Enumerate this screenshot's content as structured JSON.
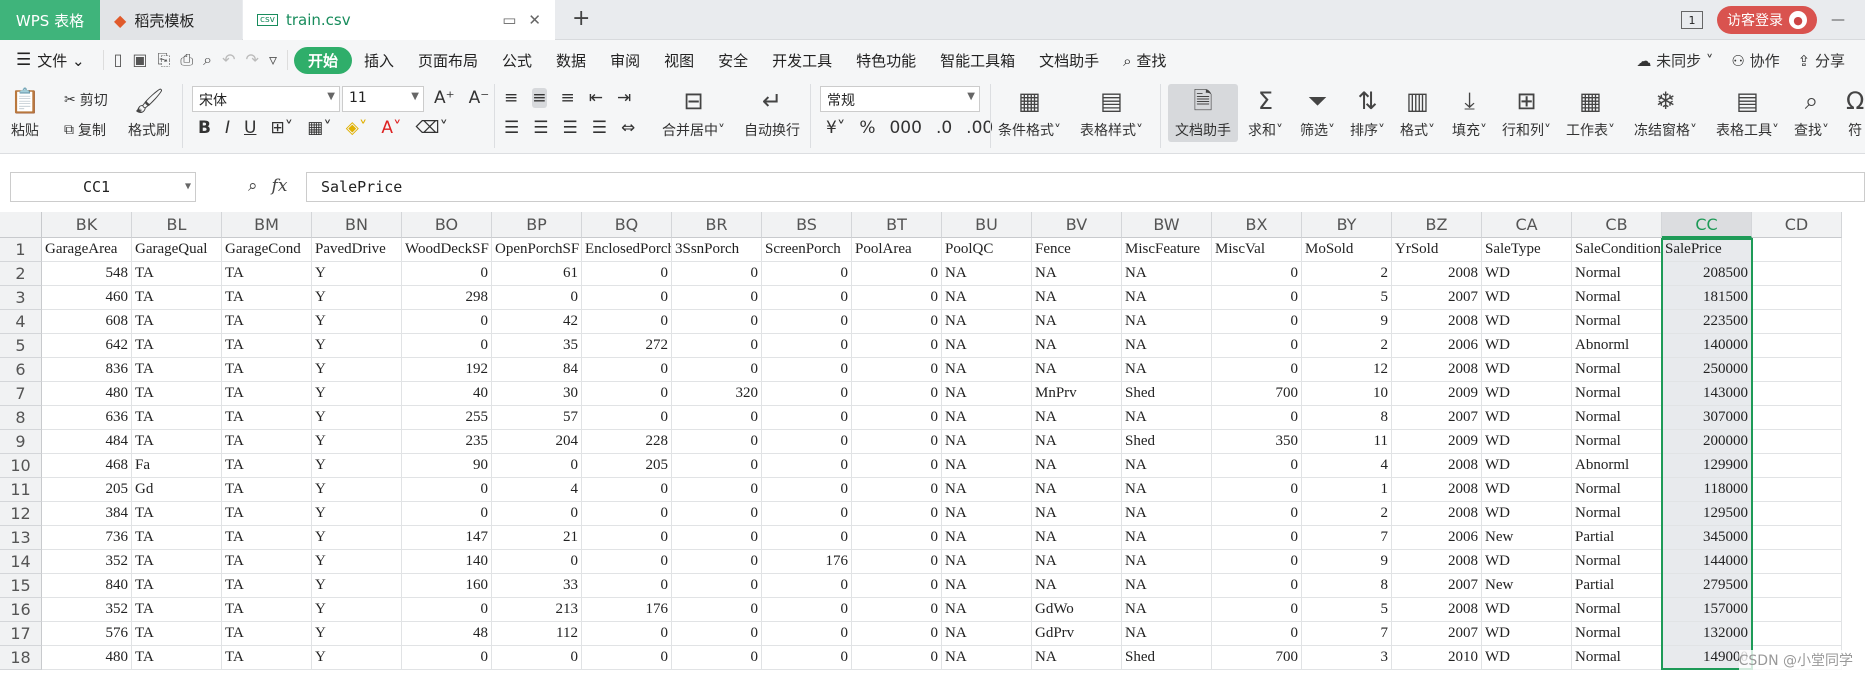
{
  "titlebar": {
    "tab_wps": "WPS 表格",
    "tab_template": "稻壳模板",
    "tab_file": "train.csv",
    "page_badge": "1",
    "login_label": "访客登录"
  },
  "menubar": {
    "file": "文件",
    "items": [
      "开始",
      "插入",
      "页面布局",
      "公式",
      "数据",
      "审阅",
      "视图",
      "安全",
      "开发工具",
      "特色功能",
      "智能工具箱",
      "文档助手"
    ],
    "search": "查找",
    "sync": "未同步",
    "collab": "协作",
    "share": "分享"
  },
  "ribbon": {
    "paste": "粘贴",
    "cut": "剪切",
    "copy": "复制",
    "format_painter": "格式刷",
    "font_name": "宋体",
    "font_size": "11",
    "merge_center": "合并居中",
    "auto_wrap": "自动换行",
    "number_format": "常规",
    "cond_format": "条件格式",
    "table_style": "表格样式",
    "doc_assistant": "文档助手",
    "sum": "求和",
    "filter": "筛选",
    "sort": "排序",
    "format": "格式",
    "fill": "填充",
    "row_col": "行和列",
    "worksheet": "工作表",
    "freeze": "冻结窗格",
    "table_tools": "表格工具",
    "find": "查找",
    "symbol": "符"
  },
  "formula_bar": {
    "name_box": "CC1",
    "formula": "SalePrice"
  },
  "grid": {
    "columns": [
      "BK",
      "BL",
      "BM",
      "BN",
      "BO",
      "BP",
      "BQ",
      "BR",
      "BS",
      "BT",
      "BU",
      "BV",
      "BW",
      "BX",
      "BY",
      "BZ",
      "CA",
      "CB",
      "CC",
      "CD"
    ],
    "header": [
      "GarageArea",
      "GarageQual",
      "GarageCond",
      "PavedDrive",
      "WoodDeckSF",
      "OpenPorchSF",
      "EnclosedPorch",
      "3SsnPorch",
      "ScreenPorch",
      "PoolArea",
      "PoolQC",
      "Fence",
      "MiscFeature",
      "MiscVal",
      "MoSold",
      "YrSold",
      "SaleType",
      "SaleCondition",
      "SalePrice",
      ""
    ],
    "row_numbers": [
      "1",
      "2",
      "3",
      "4",
      "5",
      "6",
      "7",
      "8",
      "9",
      "10",
      "11",
      "12",
      "13",
      "14",
      "15",
      "16",
      "17",
      "18"
    ],
    "rows": [
      [
        "548",
        "TA",
        "TA",
        "Y",
        "0",
        "61",
        "0",
        "0",
        "0",
        "0",
        "NA",
        "NA",
        "NA",
        "0",
        "2",
        "2008",
        "WD",
        "Normal",
        "208500",
        ""
      ],
      [
        "460",
        "TA",
        "TA",
        "Y",
        "298",
        "0",
        "0",
        "0",
        "0",
        "0",
        "NA",
        "NA",
        "NA",
        "0",
        "5",
        "2007",
        "WD",
        "Normal",
        "181500",
        ""
      ],
      [
        "608",
        "TA",
        "TA",
        "Y",
        "0",
        "42",
        "0",
        "0",
        "0",
        "0",
        "NA",
        "NA",
        "NA",
        "0",
        "9",
        "2008",
        "WD",
        "Normal",
        "223500",
        ""
      ],
      [
        "642",
        "TA",
        "TA",
        "Y",
        "0",
        "35",
        "272",
        "0",
        "0",
        "0",
        "NA",
        "NA",
        "NA",
        "0",
        "2",
        "2006",
        "WD",
        "Abnorml",
        "140000",
        ""
      ],
      [
        "836",
        "TA",
        "TA",
        "Y",
        "192",
        "84",
        "0",
        "0",
        "0",
        "0",
        "NA",
        "NA",
        "NA",
        "0",
        "12",
        "2008",
        "WD",
        "Normal",
        "250000",
        ""
      ],
      [
        "480",
        "TA",
        "TA",
        "Y",
        "40",
        "30",
        "0",
        "320",
        "0",
        "0",
        "NA",
        "MnPrv",
        "Shed",
        "700",
        "10",
        "2009",
        "WD",
        "Normal",
        "143000",
        ""
      ],
      [
        "636",
        "TA",
        "TA",
        "Y",
        "255",
        "57",
        "0",
        "0",
        "0",
        "0",
        "NA",
        "NA",
        "NA",
        "0",
        "8",
        "2007",
        "WD",
        "Normal",
        "307000",
        ""
      ],
      [
        "484",
        "TA",
        "TA",
        "Y",
        "235",
        "204",
        "228",
        "0",
        "0",
        "0",
        "NA",
        "NA",
        "Shed",
        "350",
        "11",
        "2009",
        "WD",
        "Normal",
        "200000",
        ""
      ],
      [
        "468",
        "Fa",
        "TA",
        "Y",
        "90",
        "0",
        "205",
        "0",
        "0",
        "0",
        "NA",
        "NA",
        "NA",
        "0",
        "4",
        "2008",
        "WD",
        "Abnorml",
        "129900",
        ""
      ],
      [
        "205",
        "Gd",
        "TA",
        "Y",
        "0",
        "4",
        "0",
        "0",
        "0",
        "0",
        "NA",
        "NA",
        "NA",
        "0",
        "1",
        "2008",
        "WD",
        "Normal",
        "118000",
        ""
      ],
      [
        "384",
        "TA",
        "TA",
        "Y",
        "0",
        "0",
        "0",
        "0",
        "0",
        "0",
        "NA",
        "NA",
        "NA",
        "0",
        "2",
        "2008",
        "WD",
        "Normal",
        "129500",
        ""
      ],
      [
        "736",
        "TA",
        "TA",
        "Y",
        "147",
        "21",
        "0",
        "0",
        "0",
        "0",
        "NA",
        "NA",
        "NA",
        "0",
        "7",
        "2006",
        "New",
        "Partial",
        "345000",
        ""
      ],
      [
        "352",
        "TA",
        "TA",
        "Y",
        "140",
        "0",
        "0",
        "0",
        "176",
        "0",
        "NA",
        "NA",
        "NA",
        "0",
        "9",
        "2008",
        "WD",
        "Normal",
        "144000",
        ""
      ],
      [
        "840",
        "TA",
        "TA",
        "Y",
        "160",
        "33",
        "0",
        "0",
        "0",
        "0",
        "NA",
        "NA",
        "NA",
        "0",
        "8",
        "2007",
        "New",
        "Partial",
        "279500",
        ""
      ],
      [
        "352",
        "TA",
        "TA",
        "Y",
        "0",
        "213",
        "176",
        "0",
        "0",
        "0",
        "NA",
        "GdWo",
        "NA",
        "0",
        "5",
        "2008",
        "WD",
        "Normal",
        "157000",
        ""
      ],
      [
        "576",
        "TA",
        "TA",
        "Y",
        "48",
        "112",
        "0",
        "0",
        "0",
        "0",
        "NA",
        "GdPrv",
        "NA",
        "0",
        "7",
        "2007",
        "WD",
        "Normal",
        "132000",
        ""
      ],
      [
        "480",
        "TA",
        "TA",
        "Y",
        "0",
        "0",
        "0",
        "0",
        "0",
        "0",
        "NA",
        "NA",
        "Shed",
        "700",
        "3",
        "2010",
        "WD",
        "Normal",
        "149000",
        ""
      ]
    ],
    "selected_column": "CC"
  },
  "watermark": "CSDN @小堂同学",
  "colors": {
    "accent": "#2fae6a",
    "selection": "#1e9a57",
    "wps_tab": "#3fb47b",
    "login": "#d9534f"
  }
}
